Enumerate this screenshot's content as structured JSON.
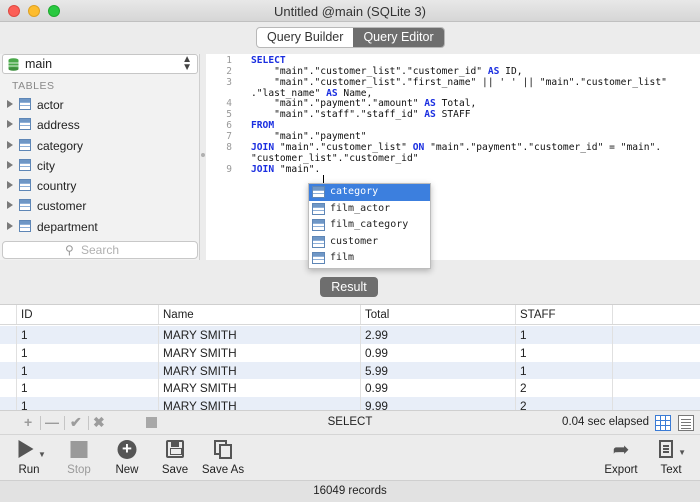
{
  "window": {
    "title": "Untitled @main (SQLite 3)"
  },
  "tabs": [
    {
      "label": "Query Builder",
      "active": false
    },
    {
      "label": "Query Editor",
      "active": true
    }
  ],
  "sidebar": {
    "database": "main",
    "section_label": "TABLES",
    "tables": [
      "actor",
      "address",
      "category",
      "city",
      "country",
      "customer",
      "department"
    ],
    "search_placeholder": "Search"
  },
  "editor": {
    "line_numbers": [
      "1",
      "2",
      "3",
      "",
      "4",
      "5",
      "6",
      "7",
      "8",
      "",
      "9"
    ],
    "lines": [
      [
        {
          "t": "SELECT",
          "kw": true
        }
      ],
      [
        {
          "t": "    \"main\".\"customer_list\".\"customer_id\" "
        },
        {
          "t": "AS",
          "kw": true
        },
        {
          "t": " ID,"
        }
      ],
      [
        {
          "t": "    \"main\".\"customer_list\".\"first_name\" || ' ' || \"main\".\"customer_list\""
        }
      ],
      [
        {
          "t": ".\"last_name\" "
        },
        {
          "t": "AS",
          "kw": true
        },
        {
          "t": " Name,"
        }
      ],
      [
        {
          "t": "    \"main\".\"payment\".\"amount\" "
        },
        {
          "t": "AS",
          "kw": true
        },
        {
          "t": " Total,"
        }
      ],
      [
        {
          "t": "    \"main\".\"staff\".\"staff_id\" "
        },
        {
          "t": "AS",
          "kw": true
        },
        {
          "t": " STAFF"
        }
      ],
      [
        {
          "t": "FROM",
          "kw": true
        }
      ],
      [
        {
          "t": "    \"main\".\"payment\""
        }
      ],
      [
        {
          "t": "JOIN",
          "kw": true
        },
        {
          "t": " \"main\".\"customer_list\" "
        },
        {
          "t": "ON",
          "kw": true
        },
        {
          "t": " \"main\".\"payment\".\"customer_id\" = \"main\"."
        }
      ],
      [
        {
          "t": "\"customer_list\".\"customer_id\""
        }
      ],
      [
        {
          "t": "JOIN",
          "kw": true
        },
        {
          "t": " \"main\"."
        }
      ]
    ]
  },
  "autocomplete": {
    "items": [
      "category",
      "film_actor",
      "film_category",
      "customer",
      "film"
    ],
    "selected_index": 0
  },
  "result_button": "Result",
  "results": {
    "columns": [
      "ID",
      "Name",
      "Total",
      "STAFF"
    ],
    "rows": [
      [
        "1",
        "MARY SMITH",
        "2.99",
        "1"
      ],
      [
        "1",
        "MARY SMITH",
        "0.99",
        "1"
      ],
      [
        "1",
        "MARY SMITH",
        "5.99",
        "1"
      ],
      [
        "1",
        "MARY SMITH",
        "0.99",
        "2"
      ],
      [
        "1",
        "MARY SMITH",
        "9.99",
        "2"
      ]
    ]
  },
  "statusbar": {
    "query_type": "SELECT",
    "elapsed": "0.04 sec elapsed"
  },
  "toolbar": {
    "run": "Run",
    "stop": "Stop",
    "new": "New",
    "save": "Save",
    "save_as": "Save As",
    "export": "Export",
    "text": "Text"
  },
  "footer": {
    "records": "16049 records"
  },
  "colors": {
    "keyword": "#1a2ee0",
    "selection": "#3c7fde",
    "row_alt": "#e8eef8"
  }
}
